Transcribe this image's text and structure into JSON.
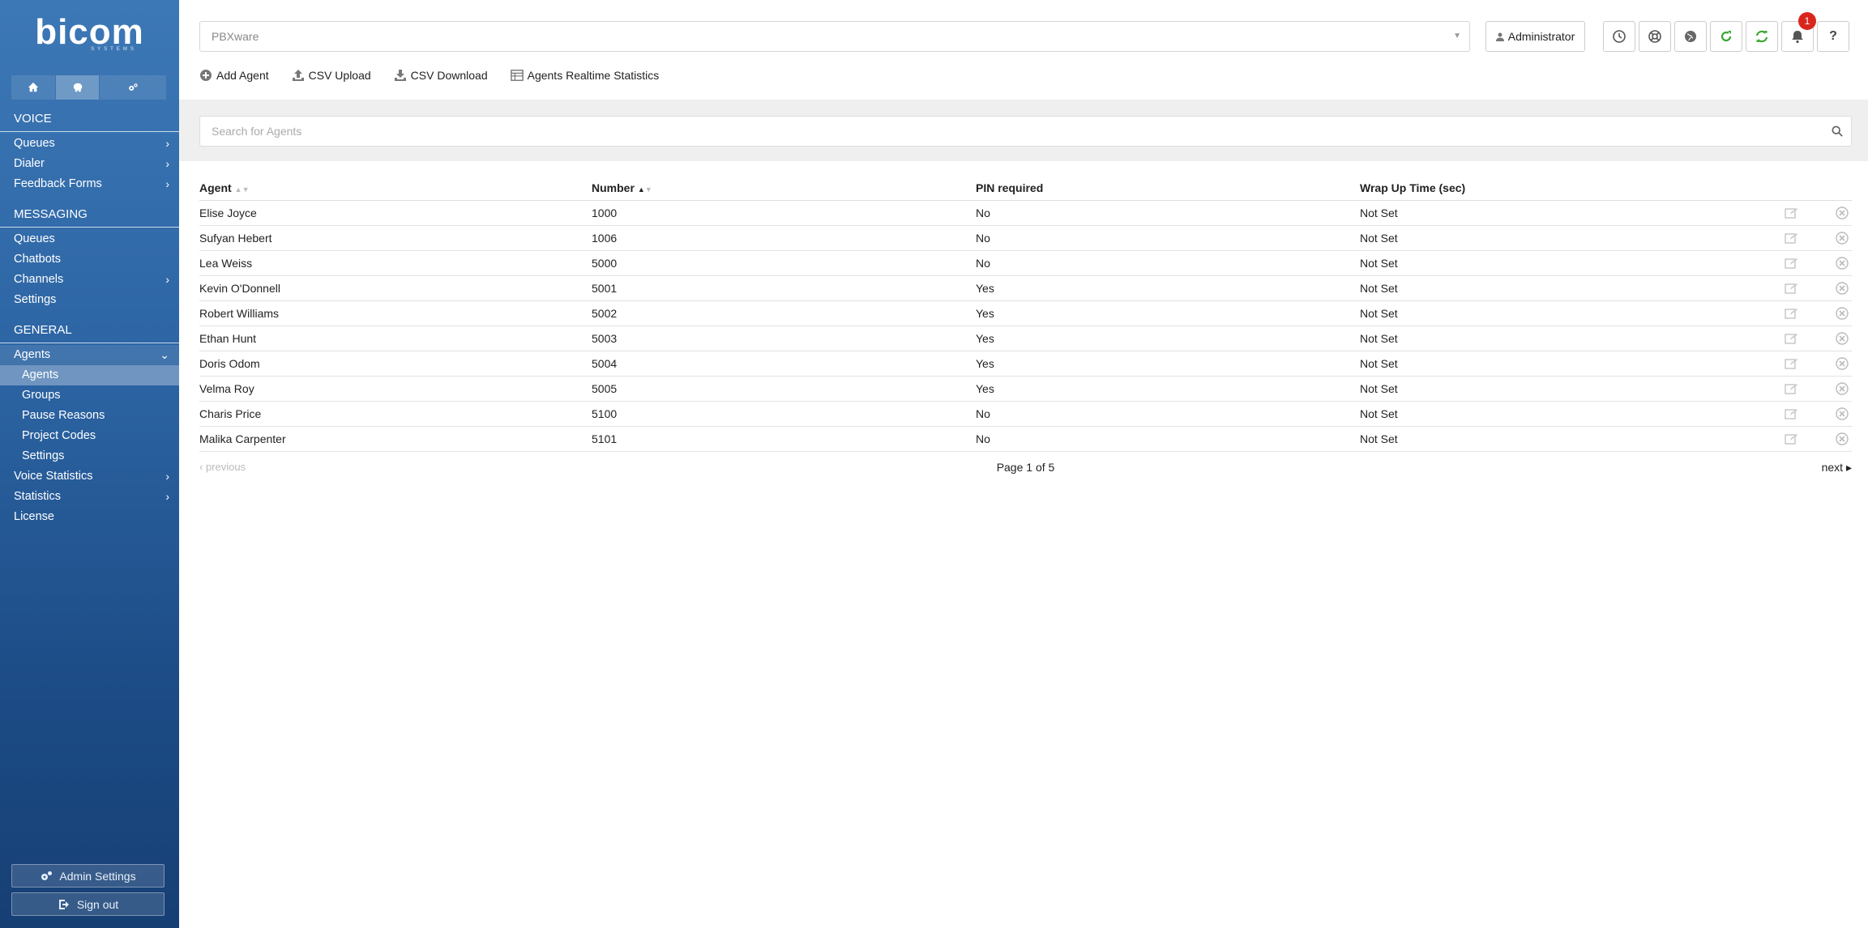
{
  "brand": {
    "name": "bicom",
    "sub": "SYSTEMS"
  },
  "sidebar": {
    "tabs": [
      {
        "icon": "home-icon"
      },
      {
        "icon": "brain-icon"
      },
      {
        "icon": "gears-icon"
      }
    ],
    "voice_header": "VOICE",
    "voice_items": [
      "Queues",
      "Dialer",
      "Feedback Forms"
    ],
    "messaging_header": "MESSAGING",
    "messaging_items": [
      "Queues",
      "Chatbots",
      "Channels",
      "Settings"
    ],
    "general_header": "GENERAL",
    "agents_label": "Agents",
    "agents_sub": [
      "Agents",
      "Groups",
      "Pause Reasons",
      "Project Codes",
      "Settings"
    ],
    "general_items": [
      "Voice Statistics",
      "Statistics",
      "License"
    ],
    "admin_settings": "Admin Settings",
    "sign_out": "Sign out"
  },
  "header": {
    "server_select": "PBXware",
    "admin_label": "Administrator",
    "notification_count": "1",
    "help_label": "?"
  },
  "toolbar": {
    "add_agent": "Add Agent",
    "csv_upload": "CSV Upload",
    "csv_download": "CSV Download",
    "realtime": "Agents Realtime Statistics"
  },
  "search": {
    "placeholder": "Search for Agents"
  },
  "table": {
    "headers": [
      "Agent",
      "Number",
      "PIN required",
      "Wrap Up Time (sec)"
    ],
    "rows": [
      [
        "Elise Joyce",
        "1000",
        "No",
        "Not Set"
      ],
      [
        "Sufyan Hebert",
        "1006",
        "No",
        "Not Set"
      ],
      [
        "Lea Weiss",
        "5000",
        "No",
        "Not Set"
      ],
      [
        "Kevin O'Donnell",
        "5001",
        "Yes",
        "Not Set"
      ],
      [
        "Robert Williams",
        "5002",
        "Yes",
        "Not Set"
      ],
      [
        "Ethan Hunt",
        "5003",
        "Yes",
        "Not Set"
      ],
      [
        "Doris Odom",
        "5004",
        "Yes",
        "Not Set"
      ],
      [
        "Velma Roy",
        "5005",
        "Yes",
        "Not Set"
      ],
      [
        "Charis Price",
        "5100",
        "No",
        "Not Set"
      ],
      [
        "Malika Carpenter",
        "5101",
        "No",
        "Not Set"
      ]
    ]
  },
  "pager": {
    "previous": "previous",
    "page_info": "Page 1 of 5",
    "next": "next"
  }
}
